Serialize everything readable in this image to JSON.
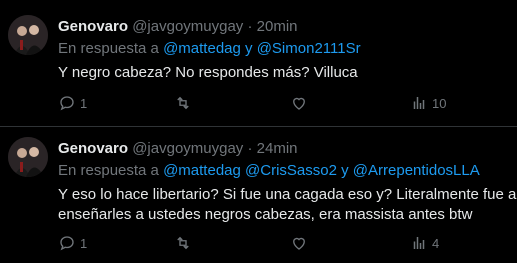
{
  "tweets": [
    {
      "name": "Genovaro",
      "handle": "@javgoymuygay",
      "separator": "·",
      "time": "20min",
      "reply_prefix": "En respuesta a",
      "mentions_1": "@mattedag",
      "joiner_1": " y ",
      "mentions_2": "@Simon2111Sr",
      "text_lines": [
        "Y negro cabeza? No respondes más? Villuca"
      ],
      "reply_count": "1",
      "retweet_count": "",
      "like_count": "",
      "views_count": "10"
    },
    {
      "name": "Genovaro",
      "handle": "@javgoymuygay",
      "separator": "·",
      "time": "24min",
      "reply_prefix": "En respuesta a",
      "mentions_1": "@mattedag @CrisSasso2",
      "joiner_1": " y ",
      "mentions_2": "@ArrepentidosLLA",
      "text_lines": [
        "Y eso lo hace libertario? Si fue una cagada eso y? Literalmente fue a",
        "enseñarles a ustedes negros cabezas, era massista antes btw"
      ],
      "reply_count": "1",
      "retweet_count": "",
      "like_count": "",
      "views_count": "4"
    }
  ],
  "colors": {
    "background": "#000000",
    "text": "#e7e9ea",
    "muted": "#71767b",
    "link": "#1d9bf0"
  },
  "icons": {
    "reply": "reply-icon",
    "retweet": "retweet-icon",
    "like": "heart-icon",
    "views": "views-icon"
  }
}
